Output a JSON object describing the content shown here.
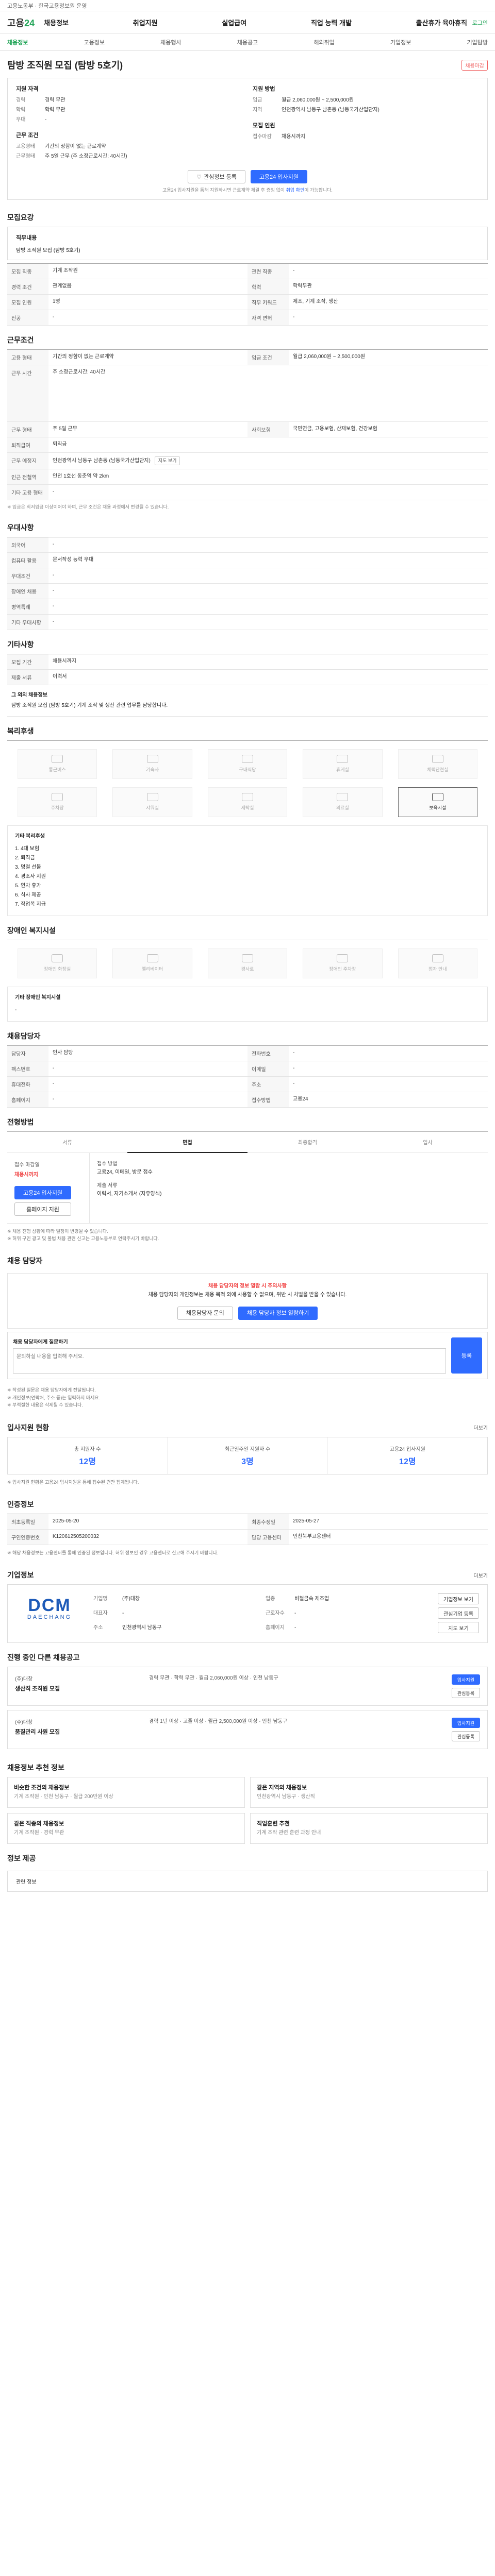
{
  "topbar": {
    "text": "고용노동부 · 한국고용정보원 운영"
  },
  "header": {
    "logo_a": "고용",
    "logo_b": "24",
    "menu": [
      "채용정보",
      "취업지원",
      "실업급여",
      "직업 능력 개발",
      "출산휴가 육아휴직"
    ],
    "right": "로그인"
  },
  "subnav": [
    "채용정보",
    "고용정보",
    "채용행사",
    "채용공고",
    "해외취업",
    "기업정보",
    "기업탐방"
  ],
  "title": "탐방 조직원 모집 (탐방 5호기)",
  "badge": "채용마감",
  "summary": {
    "left_h": "지원 자격",
    "left": [
      {
        "k": "경력",
        "v": "경력 무관"
      },
      {
        "k": "학력",
        "v": "학력 무관"
      },
      {
        "k": "우대",
        "v": "-"
      }
    ],
    "left_h2": "근무 조건",
    "left2": [
      {
        "k": "고용형태",
        "v": "기간의 정함이 없는 근로계약"
      },
      {
        "k": "근무형태",
        "v": "주 5일 근무 (주 소정근로시간: 40시간)"
      }
    ],
    "right_h": "지원 방법",
    "right": [
      {
        "k": "임금",
        "v": "월급 2,060,000원 ~ 2,500,000원"
      },
      {
        "k": "지역",
        "v": "인천광역시 남동구 남촌동 (남동국가산업단지)"
      }
    ],
    "right_h2": "모집 인원",
    "right2": [
      {
        "k": "접수마감",
        "v": "채용시까지"
      }
    ],
    "btn_save": "관심정보 등록",
    "btn_apply": "고용24 입사지원",
    "note": "고용24 입사지원을 통해 지원하시면 근로계약 체결 후 증빙 없이",
    "note_link": "취업 확인",
    "note_tail": "이 가능합니다."
  },
  "recruit": {
    "title": "모집요강",
    "job_h": "직무내용",
    "job": "탐방 조직원 모집 (탐방 5호기)",
    "rows": [
      {
        "k": "모집 직종",
        "v": "기계 조작원"
      },
      {
        "k": "관련 직종",
        "v": "-"
      },
      {
        "k": "경력 조건",
        "v": "관계없음"
      },
      {
        "k": "학력",
        "v": "학력무관"
      },
      {
        "k": "모집 인원",
        "v": "1명"
      },
      {
        "k": "직무 키워드",
        "v": "제조, 기계 조작, 생산"
      },
      {
        "k": "전공",
        "v": "-"
      },
      {
        "k": "자격 면허",
        "v": "-"
      }
    ]
  },
  "conditions": {
    "title": "근무조건",
    "rows": [
      {
        "k": "고용 형태",
        "v": "기간의 정함이 없는 근로계약"
      },
      {
        "k": "임금 조건",
        "v": "월급 2,060,000원 ~ 2,500,000원"
      },
      {
        "k": "근무 시간",
        "v": "주 소정근로시간: 40시간"
      },
      {
        "k": "근무 형태",
        "v": "주 5일 근무"
      },
      {
        "k": "사회보험",
        "v": "국민연금, 고용보험, 산재보험, 건강보험"
      },
      {
        "k": "퇴직급여",
        "v": "퇴직금"
      },
      {
        "k": "근무 예정지",
        "v": "인천광역시 남동구 남촌동 (남동국가산업단지)"
      },
      {
        "k": "인근 전철역",
        "v": "인천 1호선 동춘역 약 2km"
      },
      {
        "k": "기타 고용 형태",
        "v": "-"
      }
    ],
    "map_btn": "지도 보기",
    "footnote": "※ 임금은 최저임금 이상이어야 하며, 근무 조건은 채용 과정에서 변경될 수 있습니다."
  },
  "priority": {
    "title": "우대사항",
    "rows": [
      {
        "k": "외국어",
        "v": "-"
      },
      {
        "k": "컴퓨터 활용",
        "v": "문서작성 능력 우대"
      },
      {
        "k": "우대조건",
        "v": "-"
      },
      {
        "k": "장애인 채용",
        "v": "-"
      },
      {
        "k": "병역특례",
        "v": "-"
      },
      {
        "k": "기타 우대사항",
        "v": "-"
      }
    ]
  },
  "etc": {
    "title": "기타사항",
    "rows": [
      {
        "k": "모집 기간",
        "v": "채용시까지"
      },
      {
        "k": "제출 서류",
        "v": "이력서"
      }
    ],
    "desc_h": "그 외의 채용정보",
    "desc": "탐방 조직원 모집 (탐방 5호기) 기계 조작 및 생산 관련 업무를 담당합니다."
  },
  "welfare_facility": {
    "title": "복리후생",
    "items": [
      "통근버스",
      "기숙사",
      "구내식당",
      "휴게실",
      "체력단련실",
      "주차장",
      "샤워실",
      "세탁실",
      "의료실",
      "보육시설"
    ],
    "highlight": 9,
    "list_h": "기타 복리후생",
    "list": [
      "1. 4대 보험",
      "2. 퇴직금",
      "3. 명절 선물",
      "4. 경조사 지원",
      "5. 연차 휴가",
      "6. 식사 제공",
      "7. 작업복 지급"
    ]
  },
  "disability": {
    "title": "장애인 복지시설",
    "items": [
      "장애인 화장실",
      "엘리베이터",
      "경사로",
      "장애인 주차장",
      "점자 안내"
    ],
    "list_h": "기타 장애인 복지시설",
    "list": "-"
  },
  "contact_manager": {
    "title": "채용담당자",
    "rows": [
      {
        "k": "담당자",
        "v": "인사 담당"
      },
      {
        "k": "전화번호",
        "v": "-"
      },
      {
        "k": "팩스번호",
        "v": "-"
      },
      {
        "k": "이메일",
        "v": "-"
      },
      {
        "k": "휴대전화",
        "v": "-"
      },
      {
        "k": "주소",
        "v": "-"
      },
      {
        "k": "홈페이지",
        "v": "-"
      },
      {
        "k": "접수방법",
        "v": "고용24"
      }
    ]
  },
  "apply": {
    "title": "전형방법",
    "tabs": [
      "서류",
      "면접",
      "최종합격",
      "입사"
    ],
    "active": 1,
    "left_h": "접수 마감일",
    "left_v": "채용시까지",
    "left_btn1": "고용24 입사지원",
    "left_btn2": "홈페이지 지원",
    "right_h": "접수 방법",
    "right_v": "고용24, 이메일, 방문 접수",
    "right_h2": "제출 서류",
    "right_v2": "이력서, 자기소개서 (자유양식)",
    "notes": [
      "※ 채용 진행 상황에 따라 일정이 변경될 수 있습니다.",
      "※ 허위 구인 광고 및 불법 채용 관련 신고는 고용노동부로 연락주시기 바랍니다."
    ]
  },
  "qna": {
    "title": "채용 담당자",
    "notice_red": "채용 담당자의 정보 열람 시 주의사항",
    "notice": "채용 담당자의 개인정보는 채용 목적 외에 사용할 수 없으며, 위반 시 처벌을 받을 수 있습니다.",
    "btn1": "채용담당자 문의",
    "btn2": "채용 담당자 정보 열람하기",
    "label": "채용 담당자에게 질문하기",
    "placeholder": "문의하실 내용을 입력해 주세요.",
    "send": "등록",
    "notes": [
      "※ 작성된 질문은 채용 담당자에게 전달됩니다.",
      "※ 개인정보(연락처, 주소 등)는 입력하지 마세요.",
      "※ 부적절한 내용은 삭제될 수 있습니다."
    ]
  },
  "status": {
    "title": "입사지원 현황",
    "right": "더보기",
    "items": [
      {
        "k": "총 지원자 수",
        "v": "12명"
      },
      {
        "k": "최근일주일 지원자 수",
        "v": "3명"
      },
      {
        "k": "고용24 입사지원",
        "v": "12명"
      }
    ],
    "note": "※ 입사지원 현황은 고용24 입사지원을 통해 접수된 건만 집계됩니다."
  },
  "info": {
    "title": "인증정보",
    "rows": [
      {
        "k": "최초등록일",
        "v": "2025-05-20"
      },
      {
        "k": "최종수정일",
        "v": "2025-05-27"
      },
      {
        "k": "구인인증번호",
        "v": "K120612505200032"
      },
      {
        "k": "담당 고용센터",
        "v": "인천북부고용센터"
      }
    ],
    "note": "※ 해당 채용정보는 고용센터를 통해 인증된 정보입니다. 허위 정보인 경우 고용센터로 신고해 주시기 바랍니다."
  },
  "company": {
    "title": "기업정보",
    "right": "더보기",
    "logo_big": "DCM",
    "logo_small": "DAECHANG",
    "rows": [
      {
        "k": "기업명",
        "v": "(주)대창"
      },
      {
        "k": "업종",
        "v": "비철금속 제조업"
      },
      {
        "k": "대표자",
        "v": "-"
      },
      {
        "k": "근로자수",
        "v": "-"
      },
      {
        "k": "주소",
        "v": "인천광역시 남동구"
      },
      {
        "k": "홈페이지",
        "v": "-"
      }
    ],
    "btn1": "기업정보 보기",
    "btn2": "관심기업 등록",
    "btn3": "지도 보기"
  },
  "other_jobs": {
    "title": "진행 중인 다른 채용공고",
    "items": [
      {
        "co": "(주)대창",
        "title": "생산직 조직원 모집",
        "mid": "경력 무관 · 학력 무관 · 월급 2,060,000원 이상 · 인천 남동구"
      },
      {
        "co": "(주)대창",
        "title": "품질관리 사원 모집",
        "mid": "경력 1년 이상 · 고졸 이상 · 월급 2,500,000원 이상 · 인천 남동구"
      }
    ],
    "btn1": "입사지원",
    "btn2": "관심등록"
  },
  "recommend": {
    "title": "채용정보 추천 정보",
    "items": [
      {
        "t": "비슷한 조건의 채용정보",
        "d": "기계 조작원 · 인천 남동구 · 월급 200만원 이상"
      },
      {
        "t": "같은 지역의 채용정보",
        "d": "인천광역시 남동구 · 생산직"
      },
      {
        "t": "같은 직종의 채용정보",
        "d": "기계 조작원 · 경력 무관"
      },
      {
        "t": "직업훈련 추천",
        "d": "기계 조작 관련 훈련 과정 안내"
      }
    ]
  },
  "bottom": {
    "title": "정보 제공",
    "text": "관련 정보"
  }
}
